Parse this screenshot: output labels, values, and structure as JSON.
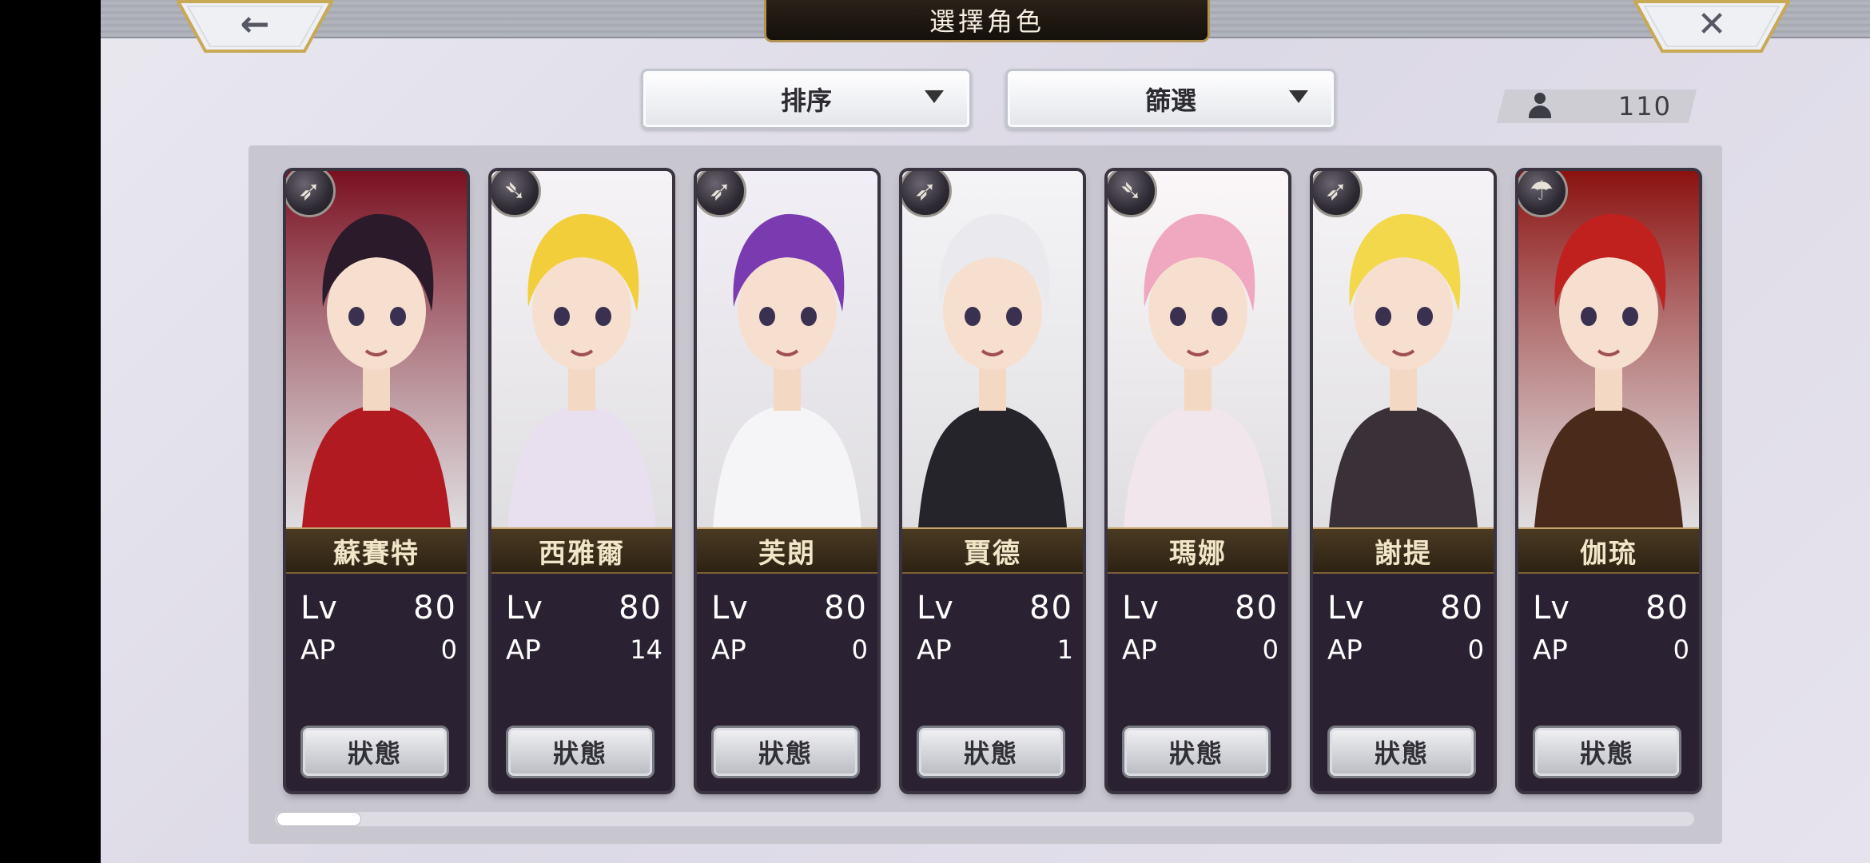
{
  "header": {
    "title": "選擇角色",
    "back_glyph": "←",
    "close_glyph": "✕"
  },
  "toolbar": {
    "sort_label": "排序",
    "filter_label": "篩選",
    "owned_count": "110"
  },
  "colors": {
    "nameplate": "#3a2d19",
    "gold_trim": "#c7a46a",
    "panel": "#c8c6cf"
  },
  "characters": [
    {
      "name": "蘇賽特",
      "lv_label": "Lv",
      "lv": "80",
      "ap_label": "AP",
      "ap": "0",
      "status_label": "狀態",
      "class_icon": "arrow-icon",
      "class_glyph": "➶",
      "hair": "#2a1a2a",
      "outfit": "#b21a22",
      "bg": "#7a1020"
    },
    {
      "name": "西雅爾",
      "lv_label": "Lv",
      "lv": "80",
      "ap_label": "AP",
      "ap": "14",
      "status_label": "狀態",
      "class_icon": "bow-icon",
      "class_glyph": "➴",
      "hair": "#f2cf3a",
      "outfit": "#e8e0ee",
      "bg": "#f6f3f7"
    },
    {
      "name": "芙朗",
      "lv_label": "Lv",
      "lv": "80",
      "ap_label": "AP",
      "ap": "0",
      "status_label": "狀態",
      "class_icon": "arrow-icon",
      "class_glyph": "➶",
      "hair": "#7a3ab0",
      "outfit": "#f5f5f8",
      "bg": "#f1eef6"
    },
    {
      "name": "賈德",
      "lv_label": "Lv",
      "lv": "80",
      "ap_label": "AP",
      "ap": "1",
      "status_label": "狀態",
      "class_icon": "arrow-icon",
      "class_glyph": "➶",
      "hair": "#e9e9ee",
      "outfit": "#25242a",
      "bg": "#f4f4f6"
    },
    {
      "name": "瑪娜",
      "lv_label": "Lv",
      "lv": "80",
      "ap_label": "AP",
      "ap": "0",
      "status_label": "狀態",
      "class_icon": "bow-icon",
      "class_glyph": "➴",
      "hair": "#f0a8c0",
      "outfit": "#f0e6ec",
      "bg": "#fbf7f9"
    },
    {
      "name": "謝提",
      "lv_label": "Lv",
      "lv": "80",
      "ap_label": "AP",
      "ap": "0",
      "status_label": "狀態",
      "class_icon": "arrow-icon",
      "class_glyph": "➶",
      "hair": "#f2d84a",
      "outfit": "#3a3038",
      "bg": "#f5f3f6"
    },
    {
      "name": "伽琉",
      "lv_label": "Lv",
      "lv": "80",
      "ap_label": "AP",
      "ap": "0",
      "status_label": "狀態",
      "class_icon": "staff-icon",
      "class_glyph": "☂",
      "hair": "#c0201e",
      "outfit": "#4a2a1a",
      "bg": "#8a1210"
    }
  ]
}
